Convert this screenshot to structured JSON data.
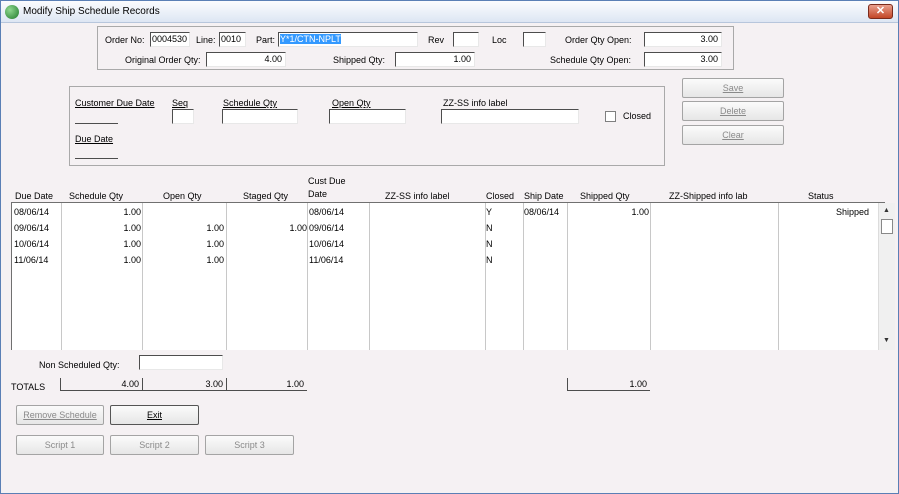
{
  "window": {
    "title": "Modify Ship Schedule Records",
    "close": "✕"
  },
  "header": {
    "order_no_label": "Order No:",
    "order_no": "0004530",
    "line_label": "Line:",
    "line": "0010",
    "part_label": "Part:",
    "part": "Y*1/CTN-NPLT",
    "rev_label": "Rev",
    "rev": "",
    "loc_label": "Loc",
    "loc": "",
    "order_qty_open_label": "Order Qty Open:",
    "order_qty_open": "3.00",
    "original_order_qty_label": "Original Order Qty:",
    "original_order_qty": "4.00",
    "shipped_qty_label": "Shipped Qty:",
    "shipped_qty": "1.00",
    "schedule_qty_open_label": "Schedule Qty Open:",
    "schedule_qty_open": "3.00"
  },
  "editor": {
    "customer_due_date_label": "Customer Due Date",
    "seq_label": "Seq",
    "schedule_qty_label": "Schedule Qty",
    "open_qty_label": "Open Qty",
    "zz_ss_label": "ZZ-SS info label",
    "closed_label": "Closed",
    "due_date_label": "Due Date"
  },
  "actions": {
    "save": "Save",
    "delete": "Delete",
    "clear": "Clear"
  },
  "grid": {
    "columns": [
      "Due Date",
      "Schedule Qty",
      "Open Qty",
      "Staged Qty",
      "Cust Due",
      "Date",
      "ZZ-SS info label",
      "Closed",
      "Ship Date",
      "Shipped Qty",
      "ZZ-Shipped info lab",
      "Status"
    ],
    "rows": [
      {
        "due": "08/06/14",
        "sched": "1.00",
        "open": "",
        "staged": "",
        "cust": "08/06/14",
        "closed": "Y",
        "ship_date": "08/06/14",
        "shipped": "1.00",
        "status": "Shipped"
      },
      {
        "due": "09/06/14",
        "sched": "1.00",
        "open": "1.00",
        "staged": "1.00",
        "cust": "09/06/14",
        "closed": "N",
        "ship_date": "",
        "shipped": "",
        "status": ""
      },
      {
        "due": "10/06/14",
        "sched": "1.00",
        "open": "1.00",
        "staged": "",
        "cust": "10/06/14",
        "closed": "N",
        "ship_date": "",
        "shipped": "",
        "status": ""
      },
      {
        "due": "11/06/14",
        "sched": "1.00",
        "open": "1.00",
        "staged": "",
        "cust": "11/06/14",
        "closed": "N",
        "ship_date": "",
        "shipped": "",
        "status": ""
      }
    ]
  },
  "footer": {
    "non_scheduled_qty_label": "Non Scheduled Qty:",
    "non_scheduled_qty": "",
    "totals_label": "TOTALS",
    "total_sched": "4.00",
    "total_open": "3.00",
    "total_staged": "1.00",
    "total_shipped": "1.00",
    "remove_schedule": "Remove Schedule",
    "exit": "Exit",
    "script1": "Script 1",
    "script2": "Script 2",
    "script3": "Script 3"
  }
}
